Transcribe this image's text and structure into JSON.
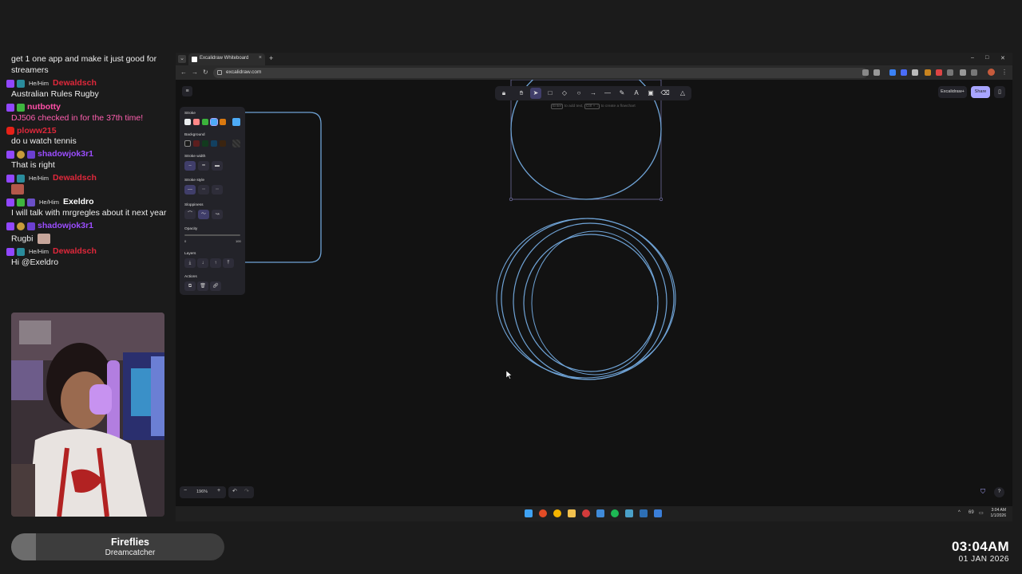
{
  "chat": [
    {
      "text": "get 1 one app and make it just good for streamers",
      "continuation": true
    },
    {
      "user": "Dewaldsch",
      "pronoun": "He/Him",
      "color": "#e0283b",
      "badges": [
        "twitch",
        "teal"
      ],
      "text": "Australian Rules Rugby"
    },
    {
      "user": "nutbotty",
      "color": "#ff4fa8",
      "badges": [
        "twitch",
        "green"
      ],
      "text": "DJ506 checked in for the 37th time!",
      "text_color": "pink"
    },
    {
      "user": "ploww215",
      "color": "#e0283b",
      "badges": [
        "youtube"
      ],
      "text": "do u watch tennis"
    },
    {
      "user": "shadowjok3r1",
      "color": "#9b4dff",
      "badges": [
        "twitch",
        "gold",
        "prime"
      ],
      "text": "That is right"
    },
    {
      "user": "Dewaldsch",
      "pronoun": "He/Him",
      "color": "#e0283b",
      "badges": [
        "twitch",
        "teal"
      ],
      "text": "",
      "emote": "red"
    },
    {
      "user": "Exeldro",
      "pronoun": "He/Him",
      "color": "#ffffff",
      "badges": [
        "twitch",
        "green",
        "mod"
      ],
      "text": "I will talk with mrgregles about it next year"
    },
    {
      "user": "shadowjok3r1",
      "color": "#9b4dff",
      "badges": [
        "twitch",
        "gold",
        "prime"
      ],
      "text": ""
    },
    {
      "user": "",
      "text": "Rugbi",
      "emote": "alt",
      "continuation": true
    },
    {
      "user": "Dewaldsch",
      "pronoun": "He/Him",
      "color": "#e0283b",
      "badges": [
        "twitch",
        "teal"
      ],
      "text": "Hi @Exeldro"
    }
  ],
  "now_playing": {
    "title": "Fireflies",
    "artist": "Dreamcatcher"
  },
  "clock": {
    "time": "03:04AM",
    "date": "01 JAN 2026"
  },
  "browser": {
    "tab_title": "Excalidraw Whiteboard",
    "url": "excalidraw.com"
  },
  "excalidraw": {
    "hint": "to add text,",
    "hint_key1": "Enter",
    "hint_key2": "Ctrl + ↓",
    "hint_tail": "to create a flowchart",
    "library_label": "Excalidraw+",
    "share_label": "Share",
    "zoom": "196%",
    "panel": {
      "stroke": "Stroke",
      "background": "Background",
      "stroke_width": "Stroke width",
      "stroke_style": "Stroke style",
      "sloppiness": "Sloppiness",
      "opacity": "Opacity",
      "opacity_min": "0",
      "opacity_max": "100",
      "layers": "Layers",
      "actions": "Actions"
    },
    "stroke_colors": [
      "#e9ecef",
      "#ff8787",
      "#3bb33b",
      "#4dabf7",
      "#d9780f"
    ],
    "current_stroke": "#4dabf7",
    "bg_colors": [
      "transparent",
      "#5c1e1e",
      "#123a1e",
      "#124060",
      "#3a2410"
    ],
    "shape_color": "#6fa3d6"
  },
  "taskbar": {
    "tray_num": "69",
    "time": "3:04 AM",
    "date": "1/1/2026"
  }
}
